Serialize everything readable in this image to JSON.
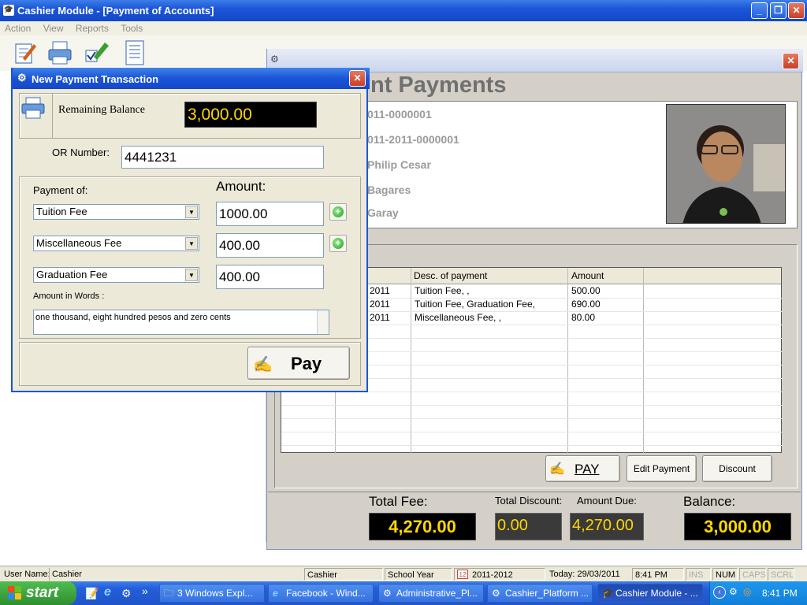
{
  "window": {
    "title": "Cashier Module - [Payment of Accounts]",
    "min": "_",
    "max": "❐",
    "close": "✕"
  },
  "menu": [
    "Action",
    "View",
    "Reports",
    "Tools"
  ],
  "child": {
    "heading": "nt Payments",
    "info": [
      "011-0000001",
      "011-2011-0000001",
      "Philip Cesar",
      "Bagares",
      "Garay"
    ],
    "grid_headers": [
      "Desc. of payment",
      "Amount"
    ],
    "grid_rows": [
      {
        "date": "2011",
        "desc": "Tuition Fee, ,",
        "amount": "500.00"
      },
      {
        "date": "2011",
        "desc": "Tuition Fee, Graduation Fee,",
        "amount": "690.00"
      },
      {
        "date": "2011",
        "desc": "Miscellaneous Fee, ,",
        "amount": "80.00"
      }
    ],
    "buttons": {
      "pay": "PAY",
      "edit": "Edit Payment",
      "discount": "Discount"
    },
    "totals": {
      "total_fee_label": "Total Fee:",
      "total_fee": "4,270.00",
      "total_discount_label": "Total Discount:",
      "total_discount": "0.00",
      "amount_due_label": "Amount Due:",
      "amount_due": "4,270.00",
      "balance_label": "Balance:",
      "balance": "3,000.00"
    }
  },
  "modal": {
    "title": "New Payment Transaction",
    "remaining_label": "Remaining Balance",
    "remaining_value": "3,000.00",
    "or_label": "OR Number:",
    "or_value": "4441231",
    "payment_of_label": "Payment of:",
    "amount_label": "Amount:",
    "rows": [
      {
        "fee": "Tuition Fee",
        "amount": "1000.00"
      },
      {
        "fee": "Miscellaneous Fee",
        "amount": "400.00"
      },
      {
        "fee": "Graduation Fee",
        "amount": "400.00"
      }
    ],
    "words_label": "Amount in Words :",
    "words_value": "one thousand, eight hundred pesos and zero cents",
    "pay_button": "Pay"
  },
  "status": {
    "user_label": "User Name:",
    "user_value": "Cashier",
    "role": "Cashier",
    "school_year_label": "School Year",
    "school_year": "2011-2012",
    "today": "Today: 29/03/2011",
    "time": "8:41 PM",
    "ins": "INS",
    "num": "NUM",
    "caps": "CAPS",
    "scrl": "SCRL"
  },
  "taskbar": {
    "start": "start",
    "tasks": [
      "3 Windows Expl...",
      "Facebook - Wind...",
      "Administrative_Pl...",
      "Cashier_Platform ...",
      "Cashier Module - ..."
    ],
    "clock": "8:41 PM",
    "chevron": "»"
  }
}
